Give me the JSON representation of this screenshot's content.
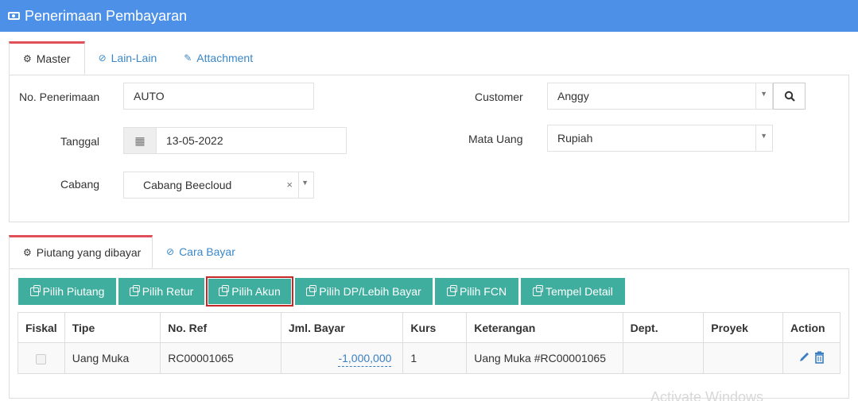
{
  "header": {
    "title": "Penerimaan Pembayaran",
    "icon": "money-icon"
  },
  "master_tabs": [
    {
      "label": "Master",
      "icon": "cogs-icon",
      "active": true
    },
    {
      "label": "Lain-Lain",
      "icon": "check-circle-icon",
      "active": false
    },
    {
      "label": "Attachment",
      "icon": "paperclip-icon",
      "active": false
    }
  ],
  "form": {
    "no_penerimaan": {
      "label": "No. Penerimaan",
      "value": "AUTO"
    },
    "tanggal": {
      "label": "Tanggal",
      "value": "13-05-2022"
    },
    "cabang": {
      "label": "Cabang",
      "value": "Cabang Beecloud"
    },
    "customer": {
      "label": "Customer",
      "value": "Anggy"
    },
    "mata_uang": {
      "label": "Mata Uang",
      "value": "Rupiah"
    }
  },
  "detail_tabs": [
    {
      "label": "Piutang yang dibayar",
      "icon": "cogs-icon",
      "active": true
    },
    {
      "label": "Cara Bayar",
      "icon": "check-circle-icon",
      "active": false
    }
  ],
  "toolbar": [
    {
      "label": "Pilih Piutang"
    },
    {
      "label": "Pilih Retur"
    },
    {
      "label": "Pilih Akun",
      "highlighted": true
    },
    {
      "label": "Pilih DP/Lebih Bayar"
    },
    {
      "label": "Pilih FCN"
    },
    {
      "label": "Tempel Detail"
    }
  ],
  "table": {
    "columns": [
      "Fiskal",
      "Tipe",
      "No. Ref",
      "Jml. Bayar",
      "Kurs",
      "Keterangan",
      "Dept.",
      "Proyek",
      "Action"
    ],
    "rows": [
      {
        "fiskal": false,
        "tipe": "Uang Muka",
        "no_ref": "RC00001065",
        "jml_bayar": "-1,000,000",
        "kurs": "1",
        "keterangan": "Uang Muka #RC00001065",
        "dept": "",
        "proyek": ""
      }
    ]
  },
  "watermark": "Activate Windows",
  "colors": {
    "header": "#4d90e8",
    "button": "#3fae9e",
    "highlight": "#c62828",
    "tab_active": "#e0505a",
    "link": "#3a87c8"
  }
}
